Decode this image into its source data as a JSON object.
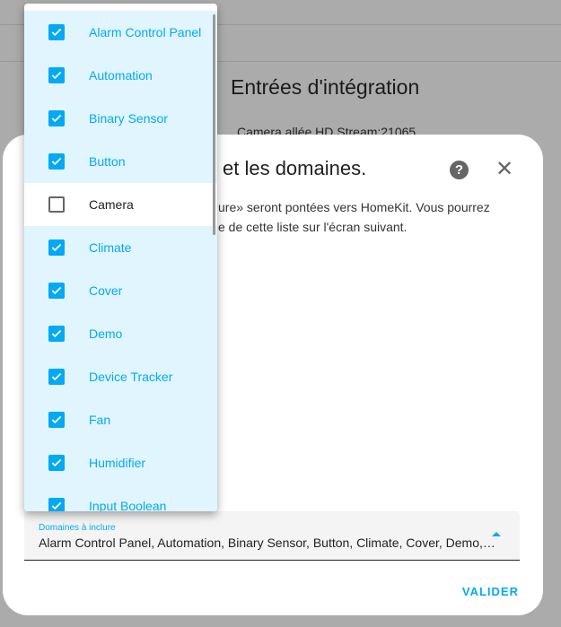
{
  "background": {
    "title": "Entrées d'intégration",
    "subtitle": "Camera allée HD Stream:21065"
  },
  "dialog": {
    "title": "et les domaines.",
    "text_line1": "ure» seront pontées vers HomeKit. Vous pourrez",
    "text_line2": "e de cette liste sur l'écran suivant.",
    "help_icon": "help-circle-icon",
    "close_icon": "close-icon",
    "field": {
      "label": "Domaines à inclure",
      "value": "Alarm Control Panel, Automation, Binary Sensor, Button, Climate, Cover, Demo, Device Tracker, Fan, Humidifier, Input Boolean"
    },
    "submit_label": "VALIDER"
  },
  "menu": {
    "items": [
      {
        "label": "Alarm Control Panel",
        "checked": true
      },
      {
        "label": "Automation",
        "checked": true
      },
      {
        "label": "Binary Sensor",
        "checked": true
      },
      {
        "label": "Button",
        "checked": true
      },
      {
        "label": "Camera",
        "checked": false
      },
      {
        "label": "Climate",
        "checked": true
      },
      {
        "label": "Cover",
        "checked": true
      },
      {
        "label": "Demo",
        "checked": true
      },
      {
        "label": "Device Tracker",
        "checked": true
      },
      {
        "label": "Fan",
        "checked": true
      },
      {
        "label": "Humidifier",
        "checked": true
      },
      {
        "label": "Input Boolean",
        "checked": true
      }
    ]
  },
  "colors": {
    "accent": "#03a9f4",
    "selected_bg": "#e1f5fe"
  }
}
